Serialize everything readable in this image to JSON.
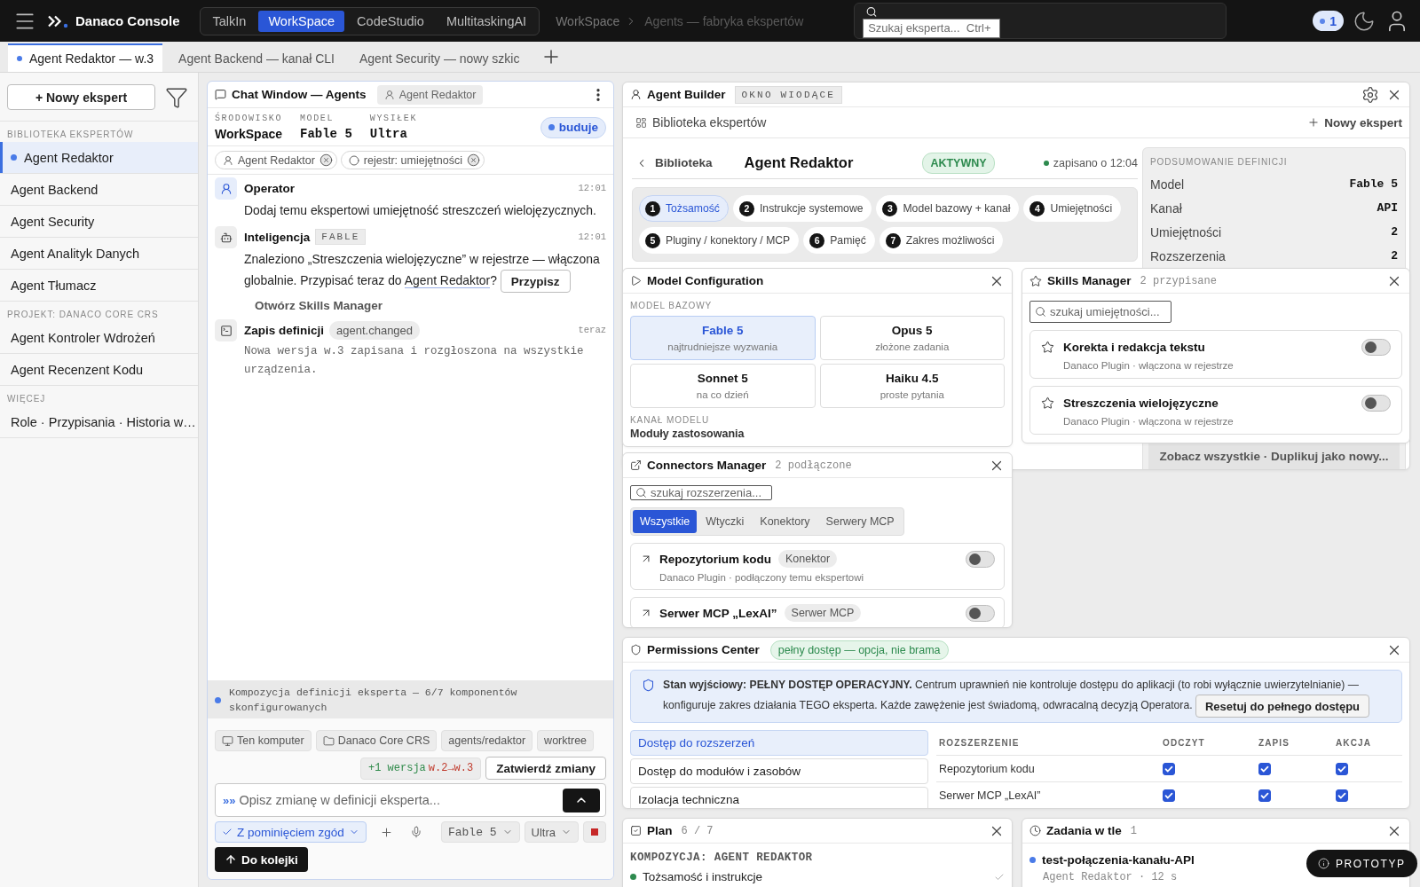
{
  "top_bar": {
    "brand": "Danaco Console",
    "app_tabs": [
      {
        "label": "TalkIn",
        "selected": false
      },
      {
        "label": "WorkSpace",
        "selected": true
      },
      {
        "label": "CodeStudio",
        "selected": false
      },
      {
        "label": "MultitaskingAI",
        "selected": false
      }
    ],
    "breadcrumb": "WorkSpace",
    "breadcrumb_current": "Agents — fabryka ekspertów",
    "search": {
      "placeholder": "Szukaj eksperta...  Ctrl+"
    },
    "notifications": "1"
  },
  "doc_tabs": [
    {
      "label": "Agent Redaktor — w.3",
      "selected": true
    },
    {
      "label": "Agent Backend — kanał CLI",
      "selected": false
    },
    {
      "label": "Agent Security — nowy szkic",
      "selected": false
    }
  ],
  "sidebar": {
    "new_button": "+ Nowy ekspert",
    "sections": [
      {
        "title": "BIBLIOTEKA EKSPERTÓW",
        "items": [
          {
            "label": "Agent Redaktor",
            "selected": true
          },
          {
            "label": "Agent Backend",
            "selected": false
          },
          {
            "label": "Agent Security",
            "selected": false
          },
          {
            "label": "Agent Analityk Danych",
            "selected": false
          },
          {
            "label": "Agent Tłumacz",
            "selected": false
          }
        ]
      },
      {
        "title": "PROJEKT: DANACO CORE CRS",
        "items": [
          {
            "label": "Agent Kontroler Wdrożeń",
            "selected": false
          },
          {
            "label": "Agent Recenzent Kodu",
            "selected": false
          }
        ]
      },
      {
        "title": "WIĘCEJ",
        "items": [
          {
            "label": "Role · Przypisania · Historia w…",
            "selected": false
          }
        ]
      }
    ]
  },
  "chat": {
    "title": "Chat Window — Agents",
    "agent_tag": "Agent Redaktor",
    "meta": [
      {
        "label": "ŚRODOWISKO",
        "value": "WorkSpace",
        "kind": "text"
      },
      {
        "label": "MODEL",
        "value": "Fable 5",
        "kind": "mono"
      },
      {
        "label": "WYSIŁEK",
        "value": "Ultra",
        "kind": "mono"
      }
    ],
    "status": "buduje",
    "context_chips": [
      {
        "label": "Agent Redaktor",
        "kind": "agent"
      },
      {
        "label": "rejestr: umiejętności",
        "kind": "registry"
      }
    ],
    "messages": [
      {
        "kind": "operator",
        "author": "Operator",
        "time": "12:01",
        "text": "Dodaj temu ekspertowi umiejętność streszczeń wielojęzycznych."
      },
      {
        "kind": "assistant",
        "author": "Inteligencja",
        "tag": "FABLE",
        "time": "12:01",
        "text": "Znaleziono „Streszczenia wielojęzyczne” w rejestrze — włączona globalnie. Przypisać teraz do ",
        "link": "Agent Redaktor",
        "text_after": "?",
        "button": "Przypisz",
        "action": "Otwórz Skills Manager"
      },
      {
        "kind": "system",
        "author": "Zapis definicji",
        "tag": "agent.changed",
        "time": "teraz",
        "text": "Nowa wersja w.3 zapisana i rozgłoszona na wszystkie urządzenia."
      }
    ],
    "progress_note": "Kompozycja definicji eksperta — 6/7 komponentów skonfigurowanych",
    "composer": {
      "scope_chips": [
        {
          "label": "Ten komputer",
          "kind": "device"
        },
        {
          "label": "Danaco Core CRS",
          "kind": "folder"
        },
        {
          "label": "agents/redaktor",
          "kind": "plain"
        },
        {
          "label": "worktree",
          "kind": "plain"
        }
      ],
      "version_added": "+1 wersja",
      "version_range": "w.2→w.3",
      "commit_button": "Zatwierdź zmiany",
      "prompt_marker": "»»",
      "placeholder": "Opisz zmianę w definicji eksperta...",
      "permission_mode": "Z pominięciem zgód",
      "model": "Fable 5",
      "effort": "Ultra",
      "queue_button": "Do kolejki"
    }
  },
  "agent_builder": {
    "title": "Agent Builder",
    "tag": "OKNO WIODĄCE",
    "library_link": "Biblioteka ekspertów",
    "new_button": "Nowy ekspert",
    "back_link": "Biblioteka",
    "agent_name": "Agent Redaktor",
    "status": "AKTYWNY",
    "saved": "zapisano o 12:04",
    "steps": [
      {
        "number": "1",
        "label": "Tożsamość",
        "selected": true
      },
      {
        "number": "2",
        "label": "Instrukcje systemowe",
        "selected": false
      },
      {
        "number": "3",
        "label": "Model bazowy + kanał",
        "selected": false
      },
      {
        "number": "4",
        "label": "Umiejętności",
        "selected": false
      },
      {
        "number": "5",
        "label": "Pluginy / konektory / MCP",
        "selected": false
      },
      {
        "number": "6",
        "label": "Pamięć",
        "selected": false
      },
      {
        "number": "7",
        "label": "Zakres możliwości",
        "selected": false
      }
    ],
    "summary": {
      "title": "PODSUMOWANIE DEFINICJI",
      "rows": [
        {
          "label": "Model",
          "value": "Fable 5"
        },
        {
          "label": "Kanał",
          "value": "API"
        },
        {
          "label": "Umiejętności",
          "value": "2"
        },
        {
          "label": "Rozszerzenia",
          "value": "2"
        }
      ],
      "footer": "Zobacz wszystkie · Duplikuj jako nowy..."
    }
  },
  "model_configuration": {
    "title": "Model Configuration",
    "base_label": "MODEL BAZOWY",
    "models": [
      {
        "name": "Fable 5",
        "note": "najtrudniejsze wyzwania",
        "selected": true
      },
      {
        "name": "Opus 5",
        "note": "złożone zadania",
        "selected": false
      },
      {
        "name": "Sonnet 5",
        "note": "na co dzień",
        "selected": false
      },
      {
        "name": "Haiku 4.5",
        "note": "proste pytania",
        "selected": false
      }
    ],
    "channel_label": "KANAŁ MODELU",
    "modules_label": "Moduły zastosowania"
  },
  "skills_manager": {
    "title": "Skills Manager",
    "count": "2 przypisane",
    "search": {
      "placeholder": "szukaj umiejętności..."
    },
    "skills": [
      {
        "name": "Korekta i redakcja tekstu",
        "source": "Danaco Plugin · włączona w rejestrze",
        "on": false
      },
      {
        "name": "Streszczenia wielojęzyczne",
        "source": "Danaco Plugin · włączona w rejestrze",
        "on": false
      }
    ]
  },
  "connectors_manager": {
    "title": "Connectors Manager",
    "count": "2 podłączone",
    "search": {
      "placeholder": "szukaj rozszerzenia..."
    },
    "filters": [
      {
        "label": "Wszystkie",
        "selected": true
      },
      {
        "label": "Wtyczki",
        "selected": false
      },
      {
        "label": "Konektory",
        "selected": false
      },
      {
        "label": "Serwery MCP",
        "selected": false
      }
    ],
    "connectors": [
      {
        "name": "Repozytorium kodu",
        "type": "Konektor",
        "source": "Danaco Plugin · podłączony temu ekspertowi",
        "on": false
      },
      {
        "name": "Serwer MCP „LexAI”",
        "type": "Serwer MCP",
        "on": false
      }
    ]
  },
  "permissions_center": {
    "title": "Permissions Center",
    "badge": "pełny dostęp — opcja, nie brama",
    "notice": "**Stan wyjściowy: PEŁNY DOSTĘP OPERACYJNY.** Centrum uprawnień nie kontroluje dostępu do aplikacji (to robi wyłącznie uwierzytelnianie) — konfiguruje zakres działania TEGO eksperta. Każde zawężenie jest świadomą, odwracalną decyzją Operatora.",
    "reset_button": "Resetuj do pełnego dostępu",
    "sections": [
      {
        "label": "Dostęp do rozszerzeń",
        "selected": true
      },
      {
        "label": "Dostęp do modułów i zasobów",
        "selected": false
      },
      {
        "label": "Izolacja techniczna",
        "selected": false
      }
    ],
    "table": {
      "columns": [
        "ROZSZERZENIE",
        "ODCZYT",
        "ZAPIS",
        "AKCJA"
      ],
      "rows": [
        {
          "name": "Repozytorium kodu",
          "permissions": [
            {
              "checked": true
            },
            {
              "checked": true
            },
            {
              "checked": true
            }
          ]
        },
        {
          "name": "Serwer MCP „LexAI”",
          "permissions": [
            {
              "checked": true
            },
            {
              "checked": true
            },
            {
              "checked": true
            }
          ]
        }
      ]
    }
  },
  "plan": {
    "title": "Plan",
    "progress": "6 / 7",
    "heading": "KOMPOZYCJA: AGENT REDAKTOR",
    "items": [
      {
        "label": "Tożsamość i instrukcje",
        "done": true
      }
    ]
  },
  "background_tasks": {
    "title": "Zadania w tle",
    "count": "1",
    "tasks": [
      {
        "name": "test-połączenia-kanału-API",
        "meta": "Agent Redaktor · 12 s"
      }
    ]
  },
  "prototype_badge": "PROTOTYP"
}
